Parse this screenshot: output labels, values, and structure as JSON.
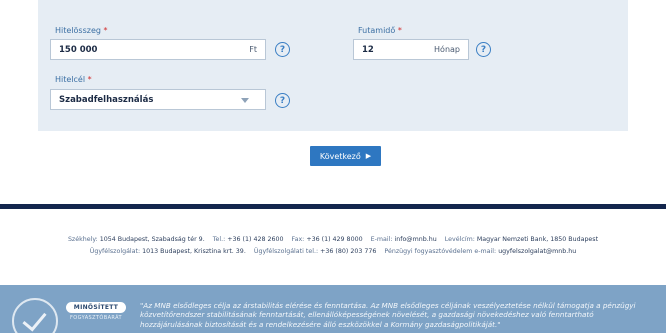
{
  "form": {
    "loan_amount": {
      "label": "Hitelösszeg",
      "required_mark": "*",
      "value": "150 000",
      "unit": "Ft",
      "help": "?"
    },
    "term": {
      "label": "Futamidő",
      "required_mark": "*",
      "value": "12",
      "unit": "Hónap",
      "help": "?"
    },
    "purpose": {
      "label": "Hitelcél",
      "required_mark": "*",
      "value": "Szabadfelhasználás",
      "help": "?"
    }
  },
  "next_button": {
    "label": "Következő",
    "arrow": "▶"
  },
  "footer": {
    "line1": {
      "seat_label": "Székhely:",
      "seat_value": "1054 Budapest, Szabadság tér 9.",
      "phone_label": "Tel.:",
      "phone_value": "+36 (1) 428 2600",
      "fax_label": "Fax:",
      "fax_value": "+36 (1) 429 8000",
      "email_label": "E-mail:",
      "email_value": "info@mnb.hu",
      "mail_label": "Levélcím:",
      "mail_value": "Magyar Nemzeti Bank, 1850 Budapest"
    },
    "line2": {
      "service_label": "Ügyfélszolgálat:",
      "service_value": "1013 Budapest, Krisztina krt. 39.",
      "service_phone_label": "Ügyfélszolgálati tel.:",
      "service_phone_value": "+36 (80) 203 776",
      "protection_label": "Pénzügyi fogyasztóvédelem e-mail:",
      "protection_value": "ugyfelszolgalat@mnb.hu"
    },
    "badge": {
      "top": "MINŐSÍTETT",
      "bottom": "FOGYASZTÓBARÁT"
    },
    "quote": "\"Az MNB elsődleges célja az árstabilitás elérése és fenntartása. Az MNB elsődleges céljának veszélyeztetése nélkül támogatja a pénzügyi közvetítőrendszer stabilitásának fenntartását, ellenállóképességének növelését, a gazdasági növekedéshez való fenntartható hozzájárulásának biztosítását és a rendelkezésére álló eszközökkel a Kormány gazdaságpolitikáját.\""
  }
}
